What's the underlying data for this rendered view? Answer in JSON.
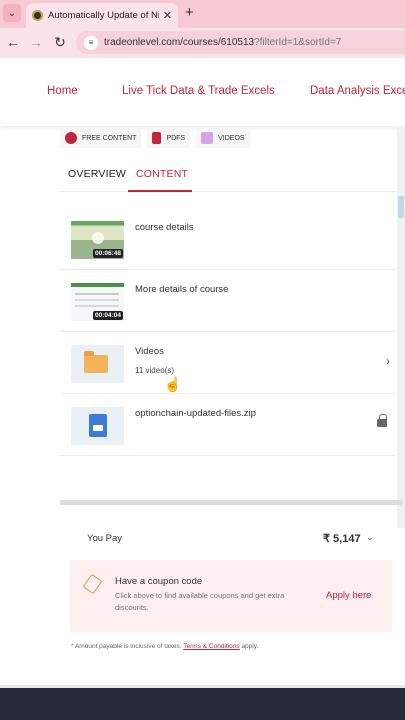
{
  "browser": {
    "tab_title": "Automatically Update of Nifty",
    "url_main": "tradeonlevel.com/courses/610513",
    "url_query": "?filterId=1&sortId=7"
  },
  "nav": {
    "links": [
      "Home",
      "Live Tick Data & Trade Excels",
      "Data Analysis Excel"
    ]
  },
  "badges": [
    {
      "label": "FREE CONTENT",
      "icon": "gear-icon",
      "color": "#c0253c"
    },
    {
      "label": "PDFS",
      "icon": "pdf-icon",
      "color": "#c0253c"
    },
    {
      "label": "VIDEOS",
      "icon": "video-icon",
      "color": "#c77ad6"
    }
  ],
  "tabs": {
    "overview": "OVERVIEW",
    "content": "CONTENT"
  },
  "items": [
    {
      "title": "course details",
      "duration": "00:06:48"
    },
    {
      "title": "More details of course",
      "duration": "00:04:04"
    },
    {
      "title": "Videos",
      "subtitle": "11 video(s)"
    },
    {
      "title": "optionchain-updated-files.zip"
    }
  ],
  "payment": {
    "label": "You Pay",
    "amount": "₹ 5,147"
  },
  "coupon": {
    "title": "Have a coupon code",
    "subtitle": "Click above to find available coupons and get extra discounts.",
    "apply": "Apply here"
  },
  "footnote": {
    "text": "* Amount payable is inclusive of taxes.",
    "link": "Terms & Conditions",
    "suffix": "apply."
  }
}
